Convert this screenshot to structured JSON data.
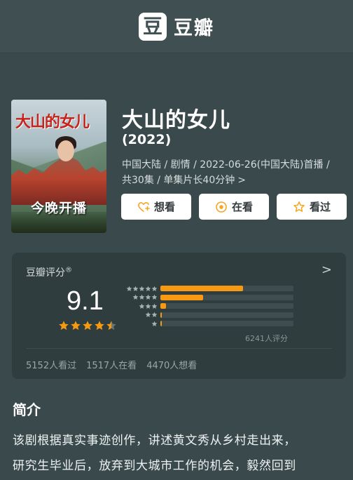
{
  "app": {
    "logo_glyph": "豆",
    "name": "豆瓣"
  },
  "poster": {
    "title_art": "大山的女儿",
    "tagline": "今晚开播"
  },
  "show": {
    "title": "大山的女儿",
    "year": "(2022)",
    "meta_line1": "中国大陆 / 剧情 / 2022-06-26(中国大陆)首播 /",
    "meta_line2": "共30集 / 单集片长40分钟",
    "meta_more": ">"
  },
  "actions": [
    {
      "label": "想看",
      "icon": "heart-plus-icon"
    },
    {
      "label": "在看",
      "icon": "target-icon"
    },
    {
      "label": "看过",
      "icon": "star-outline-icon"
    }
  ],
  "rating": {
    "label": "豆瓣评分",
    "mark": "®",
    "chevron": ">",
    "score": "9.1",
    "stars_value": 4.5,
    "distribution": [
      {
        "stars": 5,
        "fraction": 0.62
      },
      {
        "stars": 4,
        "fraction": 0.32
      },
      {
        "stars": 3,
        "fraction": 0.04
      },
      {
        "stars": 2,
        "fraction": 0.01
      },
      {
        "stars": 1,
        "fraction": 0.01
      }
    ],
    "count_text": "6241人评分",
    "watched": "5152人看过",
    "watching": "1517人在看",
    "want": "4470人想看"
  },
  "intro": {
    "heading": "简介",
    "line1": "该剧根据真实事迹创作，讲述黄文秀从乡村走出来，",
    "line2": "研究生毕业后，放弃到大城市工作的机会，毅然回到"
  },
  "colors": {
    "background": "#3a4a4c",
    "card": "#2f3d3f",
    "accent": "#f59a12",
    "poster_title": "#c8231b"
  }
}
